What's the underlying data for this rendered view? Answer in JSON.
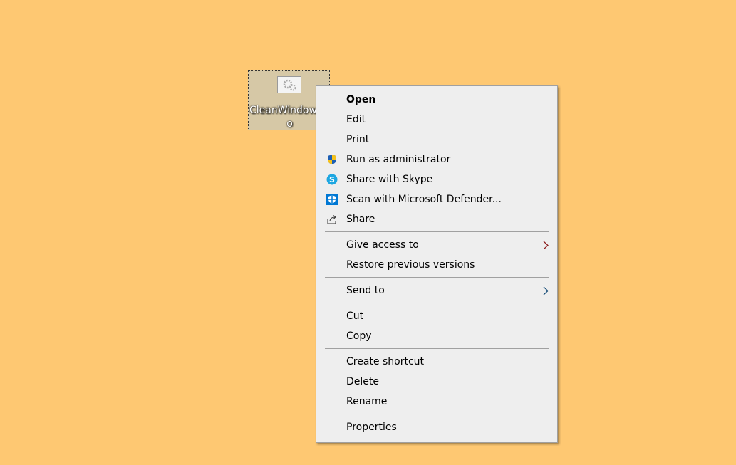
{
  "desktop_icon": {
    "label_line1": "CleanWindow",
    "label_line2": "o",
    "icon": "gears-app-icon"
  },
  "menu": {
    "groups": [
      [
        {
          "label": "Open",
          "bold": true
        },
        {
          "label": "Edit"
        },
        {
          "label": "Print"
        },
        {
          "label": "Run as administrator",
          "icon": "uac-shield-icon"
        },
        {
          "label": "Share with Skype",
          "icon": "skype-icon"
        },
        {
          "label": "Scan with Microsoft Defender...",
          "icon": "defender-icon"
        },
        {
          "label": "Share",
          "icon": "share-icon"
        }
      ],
      [
        {
          "label": "Give access to",
          "submenu": true
        },
        {
          "label": "Restore previous versions"
        }
      ],
      [
        {
          "label": "Send to",
          "submenu": true
        }
      ],
      [
        {
          "label": "Cut"
        },
        {
          "label": "Copy"
        }
      ],
      [
        {
          "label": "Create shortcut"
        },
        {
          "label": "Delete"
        },
        {
          "label": "Rename"
        }
      ],
      [
        {
          "label": "Properties"
        }
      ]
    ]
  },
  "colors": {
    "desktop": "#fec872",
    "menu_bg": "#eeeeee",
    "skype": "#1ea7e1",
    "defender": "#0078d4"
  }
}
